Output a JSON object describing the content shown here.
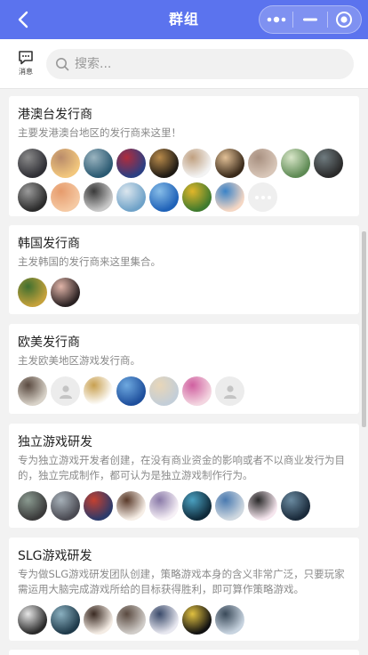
{
  "nav": {
    "title": "群组"
  },
  "toolbar": {
    "message_label": "消息"
  },
  "search": {
    "placeholder": "搜索..."
  },
  "groups": [
    {
      "title": "港澳台发行商",
      "description": "主要发港澳台地区的发行商来这里！",
      "avatars": [
        [
          "#2f2f35",
          "#8a8a8a"
        ],
        [
          "#f2c77d",
          "#b98b6a"
        ],
        [
          "#2b5a72",
          "#9ab4c0"
        ],
        [
          "#2b3f83",
          "#b02c3c"
        ],
        [
          "#1f1a14",
          "#b88a4a"
        ],
        [
          "#f3f3f3",
          "#c0a080"
        ],
        [
          "#3a2a1a",
          "#e2c096"
        ],
        [
          "#d8c6b8",
          "#a89080"
        ],
        [
          "#5e8a54",
          "#d8e6c8"
        ],
        [
          "#2a2a2a",
          "#6f7b7f"
        ],
        [
          "#2b2b2b",
          "#9a9a9a"
        ],
        [
          "#f5c9a3",
          "#e69b6c"
        ],
        [
          "#c8c8c8",
          "#3a3a3a"
        ],
        [
          "#6fa2c8",
          "#dbe6ee"
        ],
        [
          "#1f62b8",
          "#87bde8"
        ],
        [
          "#3f7a2d",
          "#e1b62a"
        ],
        [
          "#f5d7c4",
          "#3b83c7"
        ]
      ],
      "has_more": true
    },
    {
      "title": "韩国发行商",
      "description": "主发韩国的发行商来这里集合。",
      "avatars": [
        [
          "#c4a13b",
          "#3f6f2f"
        ],
        [
          "#2a2122",
          "#e0b4a8"
        ]
      ],
      "has_more": false
    },
    {
      "title": "欧美发行商",
      "description": "主发欧美地区游戏发行商。",
      "avatars": [
        [
          "#d8d2c8",
          "#5a4a40"
        ],
        [
          "blank",
          "blank"
        ],
        [
          "#ffffff",
          "#c8a050"
        ],
        [
          "#1e4f9c",
          "#6ea9e0"
        ],
        [
          "#c3ced8",
          "#e8d6b8"
        ],
        [
          "#f3d5e0",
          "#d060a0"
        ],
        [
          "blank",
          "blank"
        ]
      ],
      "has_more": false
    },
    {
      "title": "独立游戏研发",
      "description": "专为独立游戏开发者创建，在没有商业资金的影响或者不以商业发行为目的，独立完成制作，都可认为是独立游戏制作行为。",
      "avatars": [
        [
          "#3a3a3a",
          "#8a9a90"
        ],
        [
          "#4a4a52",
          "#a6b0b8"
        ],
        [
          "#2c3a6a",
          "#c44030"
        ],
        [
          "#f6eee6",
          "#5a3a2a"
        ],
        [
          "#f6f0f6",
          "#8a7aa8"
        ],
        [
          "#0f2a3a",
          "#4aa0c0"
        ],
        [
          "#cfd8e0",
          "#4a7ab0"
        ],
        [
          "#f6e6ee",
          "#2a2a2a"
        ],
        [
          "#1a2a3a",
          "#6a8aa0"
        ]
      ],
      "has_more": false
    },
    {
      "title": "SLG游戏研发",
      "description": "专为做SLG游戏研发团队创建，策略游戏本身的含义非常广泛，只要玩家需运用大脑完成游戏所给的目标获得胜利，即可算作策略游戏。",
      "avatars": [
        [
          "#2a2a2a",
          "#e6e6e6"
        ],
        [
          "#1f3a4a",
          "#8ab0c0"
        ],
        [
          "#f4ece4",
          "#3a2a22"
        ],
        [
          "#d0ccc8",
          "#5a4a40"
        ],
        [
          "#e8e8f0",
          "#3a4a6a"
        ],
        [
          "#111111",
          "#e0c040"
        ],
        [
          "#c8d4e0",
          "#3a4a5a"
        ]
      ],
      "has_more": false
    }
  ]
}
